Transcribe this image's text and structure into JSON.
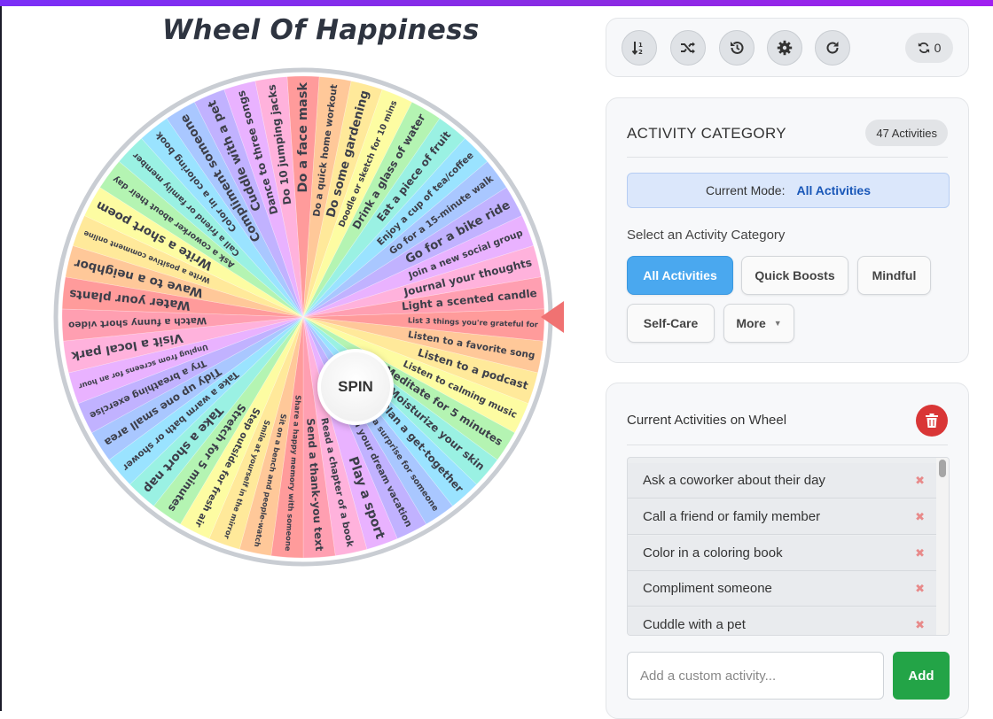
{
  "app": {
    "title": "Wheel Of Happiness"
  },
  "wheel": {
    "spin_label": "SPIN",
    "segments": [
      "Do a face mask",
      "Do a quick home workout",
      "Do some gardening",
      "Doodle or sketch for 10 mins",
      "Drink a glass of water",
      "Eat a piece of fruit",
      "Enjoy a cup of tea/coffee",
      "Go for a 15-minute walk",
      "Go for a bike ride",
      "Join a new social group",
      "Journal your thoughts",
      "Light a scented candle",
      "List 3 things you're grateful for",
      "Listen to a favorite song",
      "Listen to a podcast",
      "Listen to calming music",
      "Meditate for 5 minutes",
      "Moisturize your skin",
      "Plan a get-together",
      "Plan a surprise for someone",
      "Plan your dream vacation",
      "Play a sport",
      "Read a chapter of a book",
      "Send a thank-you text",
      "Share a happy memory with someone",
      "Sit on a bench and people-watch",
      "Smile at yourself in the mirror",
      "Step outside for fresh air",
      "Stretch for 5 minutes",
      "Take a short nap",
      "Take a warm bath or shower",
      "Tidy up one small area",
      "Try a breathing exercise",
      "Unplug from screens for an hour",
      "Visit a local park",
      "Watch a funny short video",
      "Water your plants",
      "Wave to a neighbor",
      "Write a positive comment online",
      "Write a short poem",
      "Ask a coworker about their day",
      "Call a friend or family member",
      "Color in a coloring book",
      "Compliment someone",
      "Cuddle with a pet",
      "Dance to three songs",
      "Do 10 jumping jacks"
    ],
    "colors": [
      "#ff9b9b",
      "#ffc899",
      "#ffe99a",
      "#fdfca2",
      "#b4f4b2",
      "#9af1e3",
      "#9ae3ff",
      "#a9c7ff",
      "#c1b2ff",
      "#e9b2ff",
      "#ffb2dc",
      "#ff9fb1"
    ]
  },
  "toolbar": {
    "buttons": [
      {
        "name": "sort-button",
        "icon": "sort-icon"
      },
      {
        "name": "shuffle-button",
        "icon": "shuffle-icon"
      },
      {
        "name": "history-button",
        "icon": "history-icon"
      },
      {
        "name": "settings-button",
        "icon": "gear-icon"
      },
      {
        "name": "reset-button",
        "icon": "redo-icon"
      }
    ],
    "spin_count": "0"
  },
  "category": {
    "heading": "ACTIVITY CATEGORY",
    "count_badge": "47 Activities",
    "current_mode_label": "Current Mode:",
    "current_mode_value": "All Activities",
    "select_label": "Select an Activity Category",
    "buttons": [
      "All Activities",
      "Quick Boosts",
      "Mindful",
      "Self-Care",
      "More"
    ]
  },
  "activities": {
    "heading": "Current Activities on Wheel",
    "items": [
      "Ask a coworker about their day",
      "Call a friend or family member",
      "Color in a coloring book",
      "Compliment someone",
      "Cuddle with a pet"
    ],
    "remove_symbol": "✖",
    "input_placeholder": "Add a custom activity...",
    "add_label": "Add"
  }
}
